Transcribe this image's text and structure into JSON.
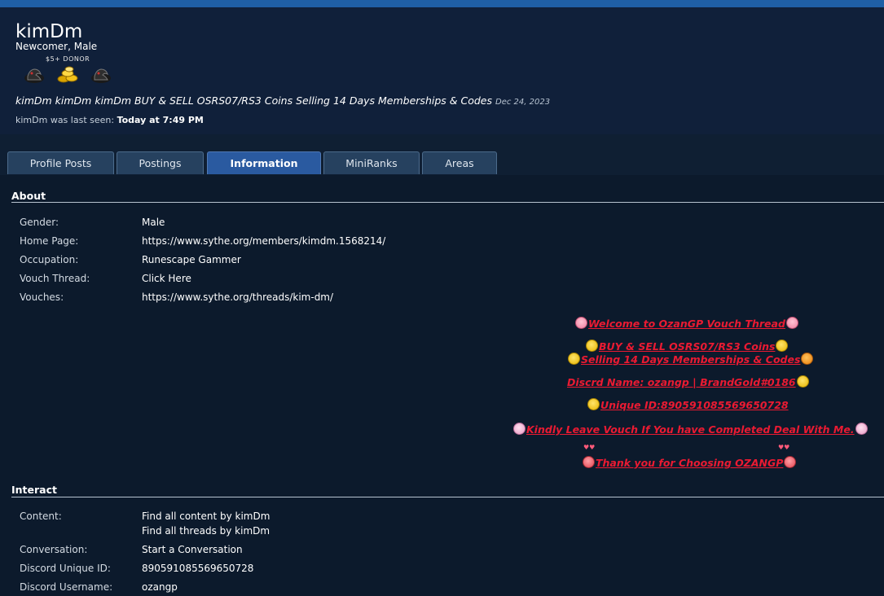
{
  "profile": {
    "username": "kimDm",
    "user_title": "Newcomer, Male",
    "donor_label": "$5+ DONOR",
    "badges": [
      "dark-horse-badge",
      "gold-coins-badge",
      "dark-horse-badge"
    ],
    "status_text": "kimDm kimDm kimDm BUY & SELL OSRS07/RS3 Coins Selling 14 Days Memberships & Codes",
    "status_date": "Dec 24, 2023",
    "last_seen_label": "kimDm was last seen:",
    "last_seen_value": "Today at 7:49 PM"
  },
  "tabs": [
    {
      "label": "Profile Posts",
      "active": false
    },
    {
      "label": "Postings",
      "active": false
    },
    {
      "label": "Information",
      "active": true
    },
    {
      "label": "MiniRanks",
      "active": false
    },
    {
      "label": "Areas",
      "active": false
    }
  ],
  "about": {
    "heading": "About",
    "rows": [
      {
        "label": "Gender:",
        "value": "Male"
      },
      {
        "label": "Home Page:",
        "value": "https://www.sythe.org/members/kimdm.1568214/"
      },
      {
        "label": "Occupation:",
        "value": "Runescape Gammer"
      },
      {
        "label": "Vouch Thread:",
        "value": "Click Here"
      },
      {
        "label": "Vouches:",
        "value": "https://www.sythe.org/threads/kim-dm/"
      }
    ]
  },
  "signature": {
    "line1": "Welcome to OzanGP Vouch Thread",
    "line2": "BUY & SELL OSRS07/RS3 Coins",
    "line3": "Selling 14 Days Memberships & Codes",
    "line4": "Discrd Name: ozangp | BrandGold#0186",
    "line5": "Unique ID:890591085569650728",
    "line6": "Kindly Leave Vouch If You have Completed Deal With Me.",
    "line7": "Thank you for Choosing OZANGP"
  },
  "interact": {
    "heading": "Interact",
    "content_label": "Content:",
    "content_link1": "Find all content by kimDm",
    "content_link2": "Find all threads by kimDm",
    "conversation_label": "Conversation:",
    "conversation_link": "Start a Conversation",
    "discord_id_label": "Discord Unique ID:",
    "discord_id_value": "890591085569650728",
    "discord_user_label": "Discord Username:",
    "discord_user_value": "ozangp"
  },
  "colors": {
    "page_bg": "#0f1f33",
    "active_tab": "#2a5aa0",
    "signature_red": "#ea1a32",
    "top_bar": "#1f5fa6"
  }
}
